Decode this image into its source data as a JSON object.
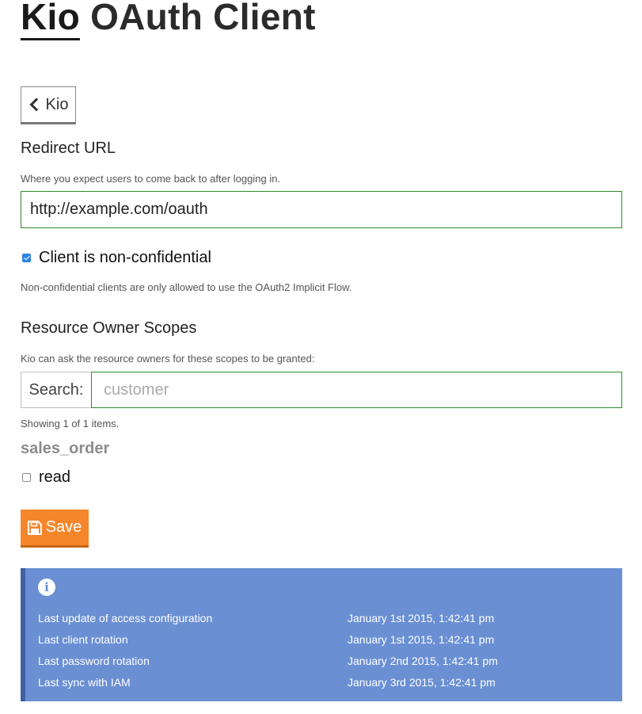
{
  "header": {
    "link_text": "Kio",
    "title_rest": " OAuth Client"
  },
  "back_button": {
    "label": "Kio",
    "icon": "chevron-left-icon"
  },
  "redirect": {
    "label": "Redirect URL",
    "help": "Where you expect users to come back to after logging in.",
    "value": "http://example.com/oauth"
  },
  "non_confidential": {
    "label": "Client is non-confidential",
    "checked": true,
    "help": "Non-confidential clients are only allowed to use the OAuth2 Implicit Flow."
  },
  "scopes": {
    "label": "Resource Owner Scopes",
    "help": "Kio can ask the resource owners for these scopes to be granted:",
    "search_label": "Search:",
    "search_placeholder": "customer",
    "showing": "Showing 1 of 1 items.",
    "groups": [
      {
        "name": "sales_order",
        "items": [
          {
            "label": "read",
            "checked": false
          }
        ]
      }
    ]
  },
  "save_button": {
    "label": "Save",
    "icon": "floppy-disk-icon"
  },
  "info": {
    "icon": "info-icon",
    "rows": [
      {
        "key": "Last update of access configuration",
        "value": "January 1st 2015, 1:42:41 pm"
      },
      {
        "key": "Last client rotation",
        "value": "January 1st 2015, 1:42:41 pm"
      },
      {
        "key": "Last password rotation",
        "value": "January 2nd 2015, 1:42:41 pm"
      },
      {
        "key": "Last sync with IAM",
        "value": "January 3rd 2015, 1:42:41 pm"
      }
    ]
  },
  "colors": {
    "primary_orange": "#f5862b",
    "info_blue": "#6a8fd3",
    "info_border": "#3f60a5",
    "input_valid_border": "#2e8b2e",
    "checkbox_checked": "#2f82e0"
  }
}
